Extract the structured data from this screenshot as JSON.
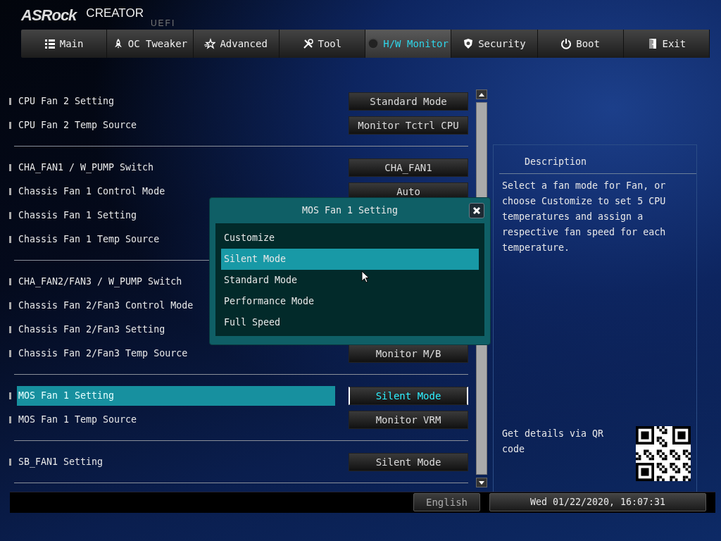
{
  "logo": {
    "brand": "ASRock",
    "product": "CREATOR",
    "edition": "UEFI"
  },
  "tabs": [
    {
      "label": "Main",
      "selected": false
    },
    {
      "label": "OC Tweaker",
      "selected": false
    },
    {
      "label": "Advanced",
      "selected": false
    },
    {
      "label": "Tool",
      "selected": false
    },
    {
      "label": "H/W Monitor",
      "selected": true
    },
    {
      "label": "Security",
      "selected": false
    },
    {
      "label": "Boot",
      "selected": false
    },
    {
      "label": "Exit",
      "selected": false
    }
  ],
  "settings": {
    "groups": [
      {
        "rows": [
          {
            "label": "CPU Fan 2 Setting",
            "value": "Standard Mode",
            "selected": false
          },
          {
            "label": "CPU Fan 2 Temp Source",
            "value": "Monitor Tctrl CPU",
            "selected": false
          }
        ]
      },
      {
        "rows": [
          {
            "label": "CHA_FAN1 / W_PUMP Switch",
            "value": "CHA_FAN1",
            "selected": false
          },
          {
            "label": "Chassis Fan 1 Control Mode",
            "value": "Auto",
            "selected": false
          },
          {
            "label": "Chassis Fan 1 Setting",
            "selected": false
          },
          {
            "label": "Chassis Fan 1 Temp Source",
            "selected": false
          }
        ]
      },
      {
        "rows": [
          {
            "label": "CHA_FAN2/FAN3 / W_PUMP Switch",
            "selected": false
          },
          {
            "label": "Chassis Fan 2/Fan3 Control Mode",
            "selected": false
          },
          {
            "label": "Chassis Fan 2/Fan3 Setting",
            "selected": false
          },
          {
            "label": "Chassis Fan 2/Fan3 Temp Source",
            "value": "Monitor M/B",
            "selected": false
          }
        ]
      },
      {
        "rows": [
          {
            "label": "MOS Fan 1 Setting",
            "value": "Silent Mode",
            "selected": true
          },
          {
            "label": "MOS Fan 1 Temp Source",
            "value": "Monitor VRM",
            "selected": false
          }
        ]
      },
      {
        "rows": [
          {
            "label": "SB_FAN1 Setting",
            "value": "Silent Mode",
            "selected": false
          }
        ]
      }
    ]
  },
  "popup": {
    "title": "MOS Fan 1 Setting",
    "options": [
      {
        "label": "Customize",
        "selected": false
      },
      {
        "label": "Silent Mode",
        "selected": true
      },
      {
        "label": "Standard Mode",
        "selected": false
      },
      {
        "label": "Performance Mode",
        "selected": false
      },
      {
        "label": "Full Speed",
        "selected": false
      }
    ]
  },
  "description": {
    "title": "Description",
    "text": "Select a fan mode for Fan, or choose Customize to set 5 CPU temperatures and assign a respective fan speed for each temperature.",
    "qr_caption": "Get details via QR code"
  },
  "footer": {
    "language": "English",
    "datetime": "Wed 01/22/2020, 16:07:31"
  }
}
